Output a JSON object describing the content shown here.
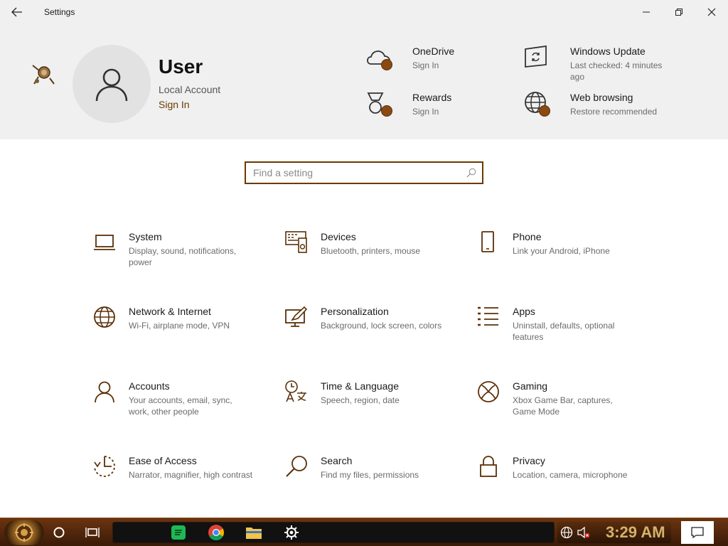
{
  "window": {
    "title": "Settings"
  },
  "profile": {
    "name": "User",
    "account_type": "Local Account",
    "sign_in": "Sign In"
  },
  "services": [
    {
      "title": "OneDrive",
      "subtitle": "Sign In",
      "icon": "cloud-icon"
    },
    {
      "title": "Rewards",
      "subtitle": "Sign In",
      "icon": "medal-icon"
    },
    {
      "title": "Windows Update",
      "subtitle": "Last checked: 4 minutes ago",
      "icon": "update-icon"
    },
    {
      "title": "Web browsing",
      "subtitle": "Restore recommended",
      "icon": "globe-icon"
    }
  ],
  "search": {
    "placeholder": "Find a setting"
  },
  "categories": [
    {
      "title": "System",
      "subtitle": "Display, sound, notifications, power",
      "icon": "laptop-icon"
    },
    {
      "title": "Devices",
      "subtitle": "Bluetooth, printers, mouse",
      "icon": "devices-icon"
    },
    {
      "title": "Phone",
      "subtitle": "Link your Android, iPhone",
      "icon": "phone-icon"
    },
    {
      "title": "Network & Internet",
      "subtitle": "Wi-Fi, airplane mode, VPN",
      "icon": "globe-icon"
    },
    {
      "title": "Personalization",
      "subtitle": "Background, lock screen, colors",
      "icon": "personalization-icon"
    },
    {
      "title": "Apps",
      "subtitle": "Uninstall, defaults, optional features",
      "icon": "apps-list-icon"
    },
    {
      "title": "Accounts",
      "subtitle": "Your accounts, email, sync, work, other people",
      "icon": "person-icon"
    },
    {
      "title": "Time & Language",
      "subtitle": "Speech, region, date",
      "icon": "time-language-icon"
    },
    {
      "title": "Gaming",
      "subtitle": "Xbox Game Bar, captures, Game Mode",
      "icon": "xbox-icon"
    },
    {
      "title": "Ease of Access",
      "subtitle": "Narrator, magnifier, high contrast",
      "icon": "ease-of-access-icon"
    },
    {
      "title": "Search",
      "subtitle": "Find my files, permissions",
      "icon": "magnifier-icon"
    },
    {
      "title": "Privacy",
      "subtitle": "Location, camera, microphone",
      "icon": "lock-icon"
    }
  ],
  "taskbar": {
    "clock": "3:29 AM"
  },
  "colors": {
    "accent": "#6b3a00",
    "taskbar": "#4a2208",
    "clock": "#d4b16a"
  }
}
